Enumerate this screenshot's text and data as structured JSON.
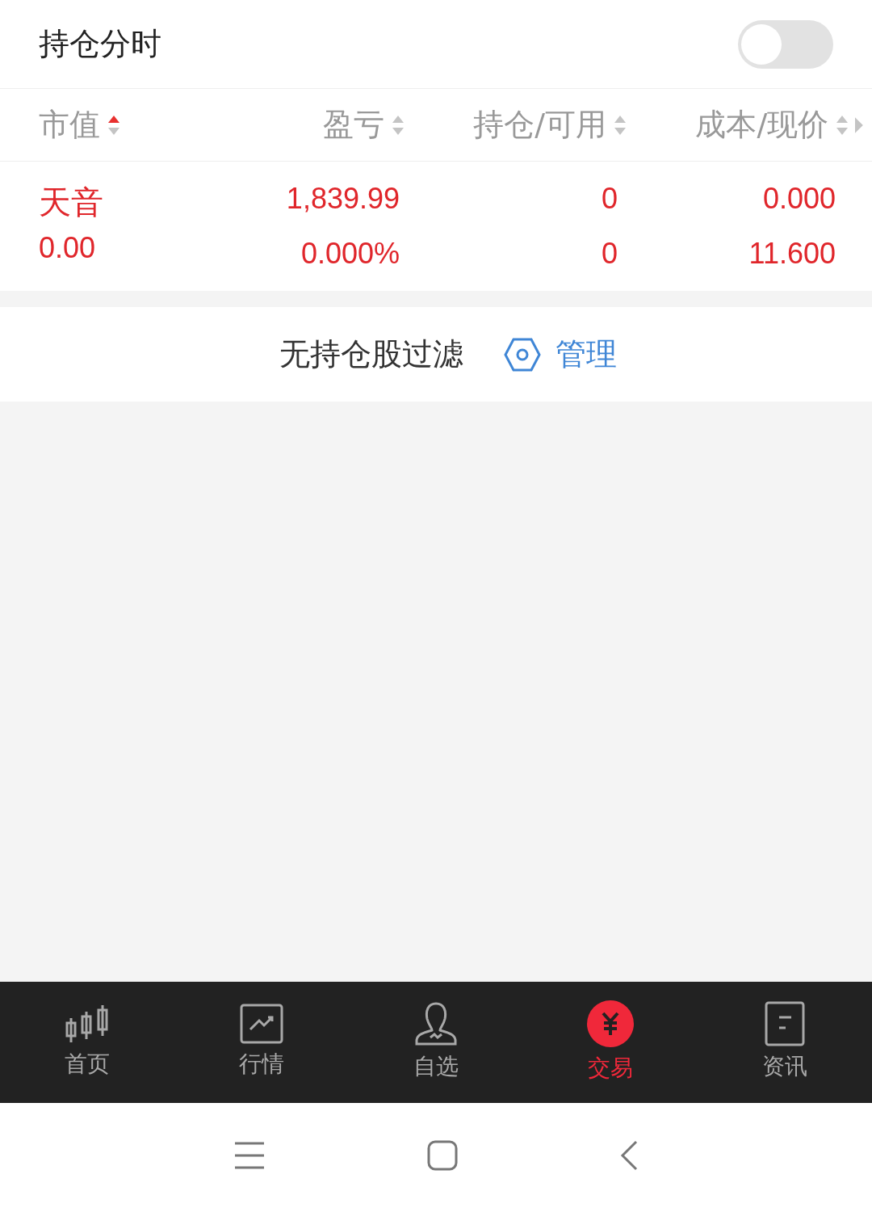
{
  "header": {
    "title": "持仓分时",
    "toggle": {
      "on": false
    }
  },
  "columns": [
    {
      "label": "市值",
      "sorted": true
    },
    {
      "label": "盈亏",
      "sorted": false
    },
    {
      "label": "持仓/可用",
      "sorted": false
    },
    {
      "label": "成本/现价",
      "sorted": false
    }
  ],
  "rows": [
    {
      "name": "天音",
      "value": "0.00",
      "pnl": "1,839.99",
      "pnl_pct": "0.000%",
      "hold": "0",
      "avail": "0",
      "cost": "0.000",
      "price": "11.600"
    }
  ],
  "filter": {
    "text": "无持仓股过滤",
    "manage": "管理"
  },
  "nav": [
    {
      "label": "首页",
      "selected": false
    },
    {
      "label": "行情",
      "selected": false
    },
    {
      "label": "自选",
      "selected": false
    },
    {
      "label": "交易",
      "selected": true
    },
    {
      "label": "资讯",
      "selected": false
    }
  ]
}
